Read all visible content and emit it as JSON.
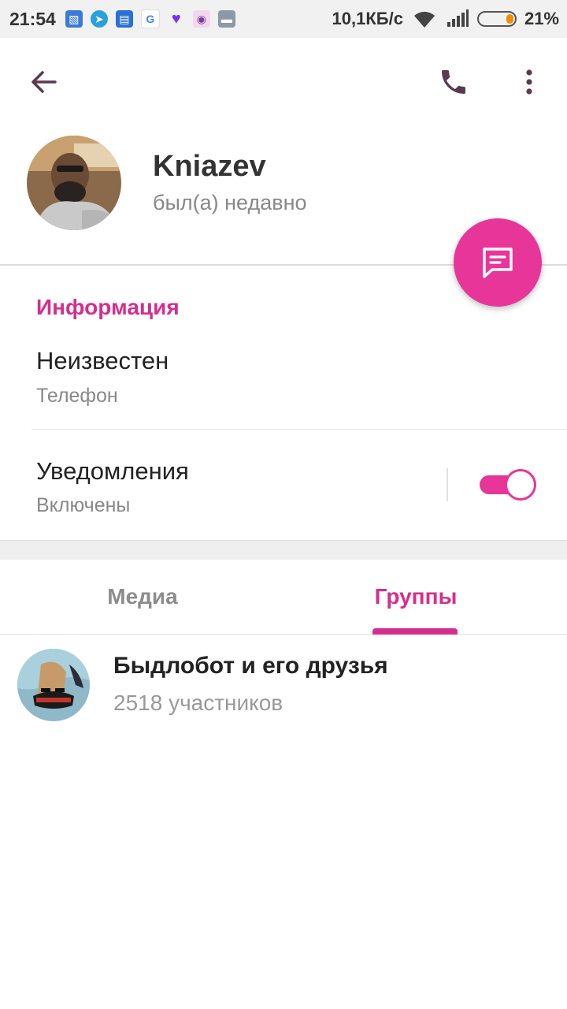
{
  "status_bar": {
    "time": "21:54",
    "network_speed": "10,1КБ/с",
    "battery_percent": "21%",
    "battery_level": 0.21,
    "notification_icons": [
      "image-icon",
      "telegram-icon",
      "files-icon",
      "google-icon",
      "viber-icon",
      "owl-icon",
      "app-icon"
    ]
  },
  "profile": {
    "name": "Kniazev",
    "status": "был(а) недавно"
  },
  "info": {
    "section_title": "Информация",
    "phone_value": "Неизвестен",
    "phone_label": "Телефон",
    "notifications_title": "Уведомления",
    "notifications_state": "Включены",
    "notifications_on": true
  },
  "tabs": [
    {
      "label": "Медиа",
      "active": false
    },
    {
      "label": "Группы",
      "active": true
    }
  ],
  "groups": [
    {
      "name": "Быдлобот и его друзья",
      "members": "2518 участников"
    }
  ],
  "colors": {
    "accent": "#e8359a",
    "accent_text": "#d42f8e",
    "icon_dark": "#5a3a50"
  }
}
